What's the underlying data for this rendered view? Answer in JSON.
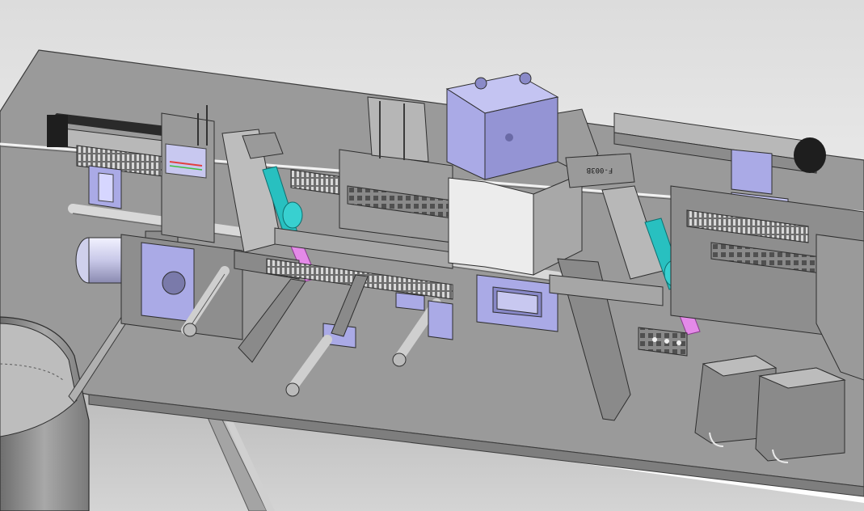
{
  "scene": {
    "part_label": "F-003B",
    "colors": {
      "background_top": "#dcdcdc",
      "background_bottom": "#ffffff",
      "table_top": "#9a9a9a",
      "table_edge": "#7e7e7e",
      "steel": "#8c8c8c",
      "steel_dark": "#4a4a4a",
      "lavender": "#aaaae6",
      "lavender_dark": "#7c7cc2",
      "cyan": "#28c0c0",
      "magenta": "#e48ae8",
      "white_block": "#ececec",
      "bowl": "#a0a0a0"
    }
  }
}
